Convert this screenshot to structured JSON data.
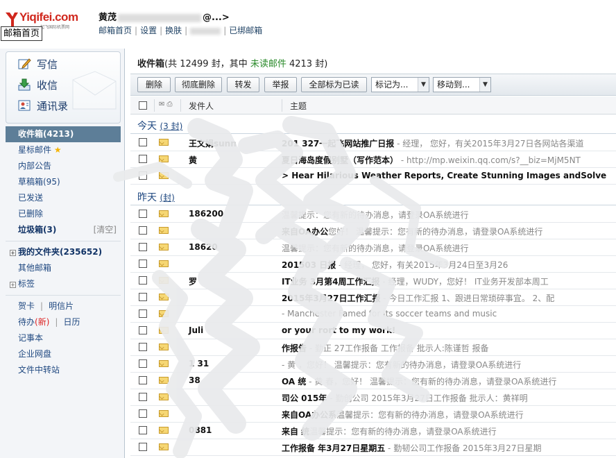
{
  "header": {
    "logo_text": "Yiqifei.com",
    "logo_sub": "一起飞国际机票网",
    "tooltip": "邮箱首页",
    "user_name_prefix": "黄茂",
    "user_name_suffix": "@...>",
    "links": [
      "邮箱首页",
      "设置",
      "换肤",
      "",
      "已绑邮箱"
    ]
  },
  "sidebar": {
    "quick": [
      {
        "label": "写信",
        "icon": "pencil-icon"
      },
      {
        "label": "收信",
        "icon": "download-icon"
      },
      {
        "label": "通讯录",
        "icon": "contacts-icon"
      }
    ],
    "folders": [
      {
        "label": "收件箱(4213)",
        "active": true
      },
      {
        "label": "星标邮件",
        "star": true
      },
      {
        "label": "内部公告"
      },
      {
        "label": "草稿箱(95)"
      },
      {
        "label": "已发送"
      },
      {
        "label": "已删除"
      },
      {
        "label": "垃圾箱(3)",
        "bold": true,
        "right": "[清空]"
      }
    ],
    "groups": [
      {
        "label": "我的文件夹(235652)",
        "bold": true,
        "plus": true
      },
      {
        "label": "其他邮箱"
      },
      {
        "label": "标签",
        "plus": true
      }
    ],
    "extras": [
      {
        "a": "贺卡",
        "b": "明信片"
      },
      {
        "a": "待办",
        "badge": "(新)",
        "b": "日历"
      },
      {
        "a": "记事本"
      },
      {
        "a": "企业网盘"
      },
      {
        "a": "文件中转站"
      }
    ]
  },
  "main": {
    "title": "收件箱",
    "count_text": "(共 12499 封，其中 ",
    "unread_label": "未读邮件",
    "unread_count": " 4213 封)",
    "buttons": [
      "删除",
      "彻底删除",
      "转发",
      "举报",
      "全部标为已读"
    ],
    "selects": [
      "标记为...",
      "移动到..."
    ],
    "columns": {
      "sender": "发件人",
      "subject": "主题"
    },
    "groups": [
      {
        "label": "今天",
        "count": "(3 封)"
      },
      {
        "label": "昨天",
        "count": "(封)"
      }
    ],
    "today_rows": [
      {
        "sender": "王文娟sunn",
        "subject": "201 327一起飞网站推广日报",
        "preview": " - 经理，      您好，有关2015年3月27日各网站各渠道"
      },
      {
        "sender": "黄",
        "subject": "夏日海岛度假别墅（写作范本）",
        "preview": " - http://mp.weixin.qq.com/s?__biz=MjM5NT"
      },
      {
        "sender": "",
        "subject": "> Hear Hilarious Weather Reports, Create Stunning Images andSolve",
        "preview": ""
      }
    ],
    "yesterday_rows": [
      {
        "sender": "186200",
        "subject": "",
        "preview": "温馨提示：您有新的待办消息，请登录OA系统进行"
      },
      {
        "sender": "",
        "subject": "来自OA办公",
        "preview": "您好！    温馨提示：您有新的待办消息，请登录OA系统进行"
      },
      {
        "sender": "18620",
        "subject": "",
        "preview": "温馨提示：您有新的待办消息，请登录OA系统进行"
      },
      {
        "sender": "",
        "subject": "201503  日报",
        "preview": " - 经理，      您好，有关2015年3月24日至3月26"
      },
      {
        "sender": "罗",
        "subject": "IT业务   3月第4周工作汇报",
        "preview": " - 经理，WUDY，您好！ IT业务开发部本周工"
      },
      {
        "sender": "",
        "subject": "2015年3月27日工作汇报",
        "preview": " - 今日工作汇报 1、跟进日常琐碎事宜。 2、配"
      },
      {
        "sender": "",
        "subject": "",
        "preview": " - Manchester Famed for its soccer teams and music"
      },
      {
        "sender": "Juli",
        "subject": "or your  rort to my work!",
        "preview": ""
      },
      {
        "sender": "",
        "subject": "作报告",
        "preview": " - 勤正   27工作报备 工作报备  批示人:陈谨哲    报备"
      },
      {
        "sender": "1   31",
        "subject": "",
        "preview": " - 黄   ，您好！    温馨提示：您有新的待办消息，请登录OA系统进行"
      },
      {
        "sender": "38",
        "subject": "OA   统",
        "preview": " - 黄   春，您好！    温馨提示：您有新的待办消息，请登录OA系统进行"
      },
      {
        "sender": "",
        "subject": "司公  015年  ",
        "preview": " - 勤创公司   2015年3月27日工作报备 批示人：黄祥明"
      },
      {
        "sender": "",
        "subject": "来自OA办公系",
        "preview": "温馨提示：您有新的待办消息，请登录OA系统进行"
      },
      {
        "sender": "0881",
        "subject": "来自  统",
        "preview": "温馨提示：您有新的待办消息，请登录OA系统进行"
      },
      {
        "sender": "",
        "subject": "工作报备    年3月27日星期五",
        "preview": " - 勤韧公司工作报备 2015年3月27日星期"
      }
    ]
  },
  "colors": {
    "accent": "#5d7e98",
    "unread": "#2a8a2a",
    "logo": "#d0271d"
  }
}
